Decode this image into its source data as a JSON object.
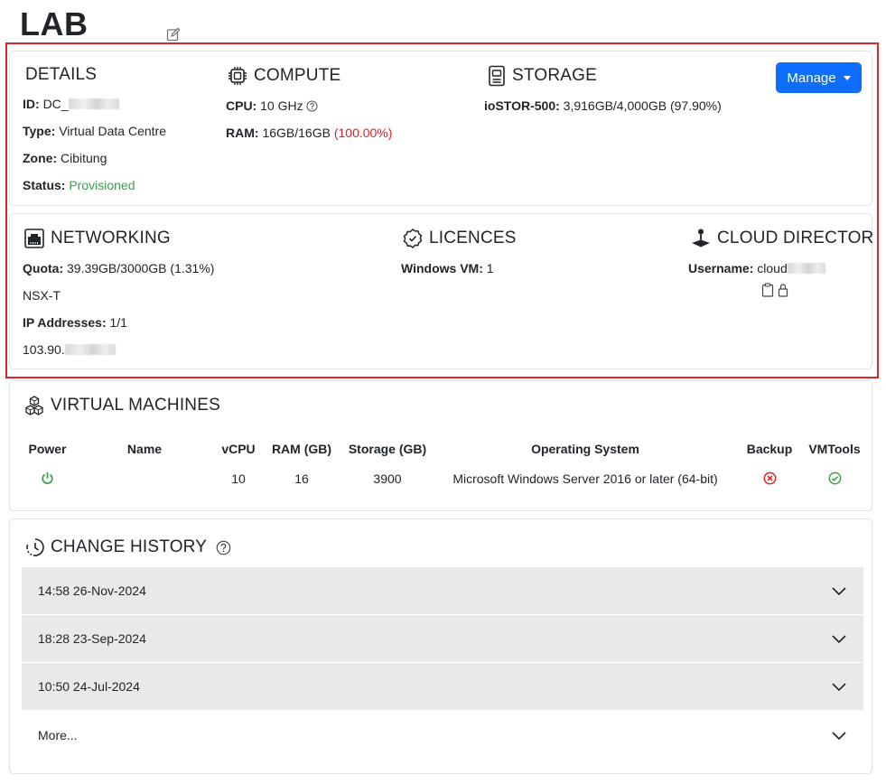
{
  "page": {
    "title": "LAB"
  },
  "details": {
    "heading": "DETAILS",
    "id_label": "ID:",
    "id_value": "DC_",
    "type_label": "Type:",
    "type_value": "Virtual Data Centre",
    "zone_label": "Zone:",
    "zone_value": "Cibitung",
    "status_label": "Status:",
    "status_value": "Provisioned"
  },
  "compute": {
    "heading": "COMPUTE",
    "cpu_label": "CPU:",
    "cpu_value": "10 GHz",
    "ram_label": "RAM:",
    "ram_value": "16GB/16GB",
    "ram_pct": "(100.00%)"
  },
  "storage": {
    "heading": "STORAGE",
    "label": "ioSTOR-500:",
    "value": "3,916GB/4,000GB (97.90%)"
  },
  "manage_button": {
    "label": "Manage"
  },
  "networking": {
    "heading": "NETWORKING",
    "quota_label": "Quota:",
    "quota_value": "39.39GB/3000GB (1.31%)",
    "type": "NSX-T",
    "ip_label": "IP Addresses:",
    "ip_value": "1/1",
    "ip_address": "103.90."
  },
  "licences": {
    "heading": "LICENCES",
    "label": "Windows VM:",
    "value": "1"
  },
  "cloud_director": {
    "heading": "CLOUD DIRECTOR",
    "username_label": "Username:",
    "username_value": "cloud"
  },
  "virtual_machines": {
    "heading": "VIRTUAL MACHINES",
    "columns": [
      "Power",
      "Name",
      "vCPU",
      "RAM (GB)",
      "Storage (GB)",
      "Operating System",
      "Backup",
      "VMTools"
    ],
    "rows": [
      {
        "name": "",
        "vcpu": "10",
        "ram": "16",
        "storage": "3900",
        "os": "Microsoft Windows Server 2016 or later (64-bit)"
      }
    ]
  },
  "change_history": {
    "heading": "CHANGE HISTORY",
    "entries": [
      "14:58 26-Nov-2024",
      "18:28 23-Sep-2024",
      "10:50 24-Jul-2024"
    ],
    "more_label": "More..."
  },
  "colors": {
    "accent": "#0d6efd",
    "success": "#3aa045",
    "danger": "#e02020",
    "highlight_border": "#d9262b"
  },
  "icons": [
    "edit-icon",
    "cpu-icon",
    "storage-drive-icon",
    "network-port-icon",
    "licence-badge-icon",
    "joystick-icon",
    "cubes-icon",
    "help-circle-icon",
    "clock-history-icon",
    "power-icon",
    "error-circle-icon",
    "check-circle-icon",
    "clipboard-icon",
    "lock-icon",
    "chevron-down-icon"
  ]
}
